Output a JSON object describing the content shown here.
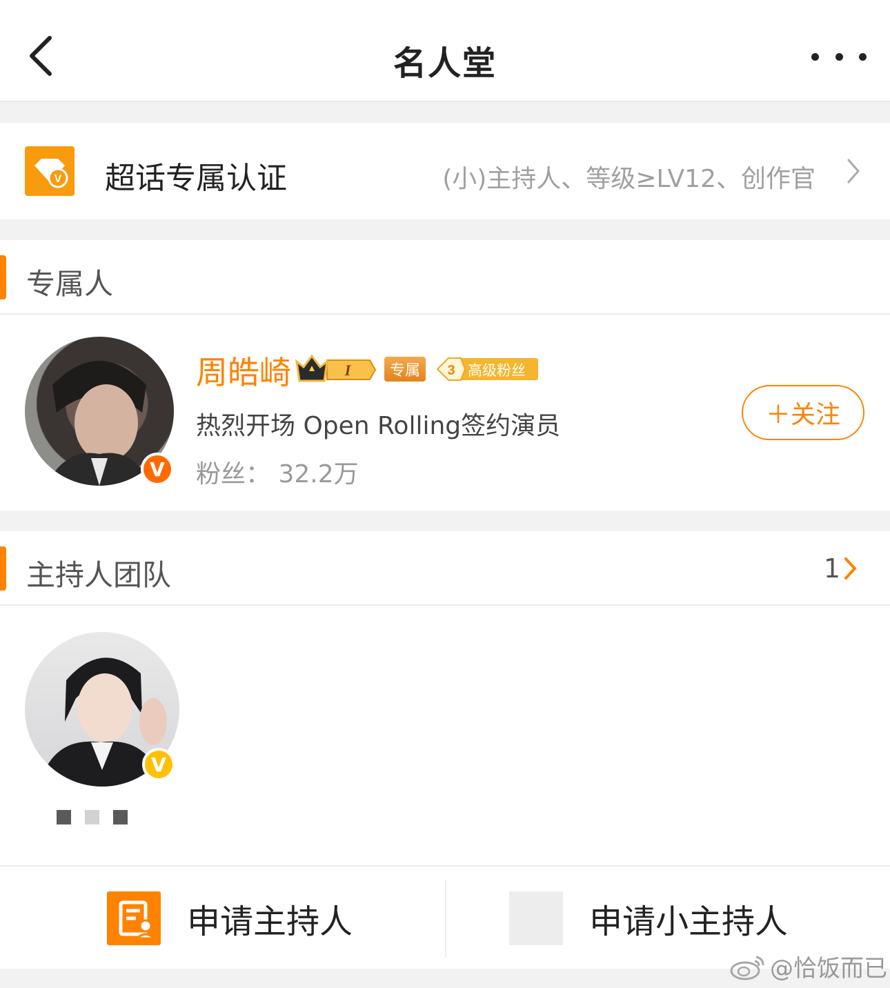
{
  "nav": {
    "title": "名人堂"
  },
  "certification": {
    "title": "超话专属认证",
    "requirements": "(小)主持人、等级≥LV12、创作官"
  },
  "exclusive": {
    "section_title": "专属人",
    "user": {
      "name": "周皓崎",
      "level_badge": "I",
      "exclusive_badge": "专属",
      "fan_level": "3",
      "fan_badge": "高级粉丝",
      "description": "热烈开场 Open Rolling签约演员",
      "fans_label": "粉丝：",
      "fans_count": "32.2万",
      "follow_label": "＋关注"
    }
  },
  "hosts": {
    "section_title": "主持人团队",
    "count": "1"
  },
  "bottom": {
    "apply_host": "申请主持人",
    "apply_small_host": "申请小主持人"
  },
  "watermark": "@恰饭而已",
  "colors": {
    "accent": "#ff8200",
    "verified_orange": "#ff6a00",
    "verified_yellow": "#ffc107"
  }
}
